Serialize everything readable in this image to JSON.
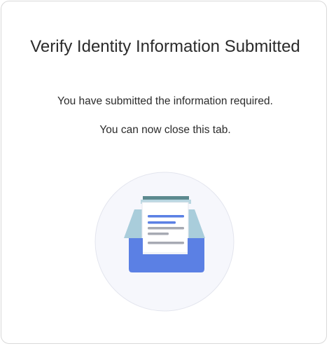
{
  "page": {
    "title": "Verify Identity Information Submitted",
    "message_submitted": "You have submitted the information required.",
    "message_close": "You can now close this tab.",
    "illustration_icon": "document-inbox-icon"
  },
  "colors": {
    "circle_bg": "#f6f7fc",
    "circle_border": "#e3e5ee",
    "tray_front": "#5b80e4",
    "tray_back": "#a9cddb",
    "paper": "#ffffff",
    "paper_top": "#5c8a8f",
    "line_accent": "#5b80e4",
    "line_gray": "#a7aab3"
  }
}
